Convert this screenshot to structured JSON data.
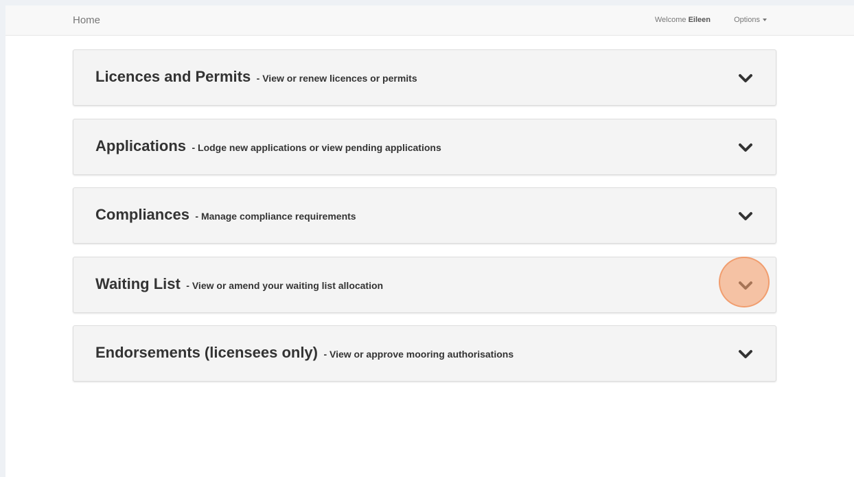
{
  "navbar": {
    "home_label": "Home",
    "welcome_prefix": "Welcome",
    "user_name": "Eileen",
    "options_label": "Options"
  },
  "panels": [
    {
      "title": "Licences and Permits",
      "description": "- View or renew licences or permits",
      "icon": "chevron-down-icon"
    },
    {
      "title": "Applications",
      "description": "- Lodge new applications or view pending applications",
      "icon": "chevron-down-icon"
    },
    {
      "title": "Compliances",
      "description": "- Manage compliance requirements",
      "icon": "chevron-down-icon"
    },
    {
      "title": "Waiting List",
      "description": "- View or amend your waiting list allocation",
      "icon": "chevron-down-icon"
    },
    {
      "title": "Endorsements (licensees only)",
      "description": "- View or approve mooring authorisations",
      "icon": "chevron-down-icon"
    }
  ],
  "colors": {
    "accent_highlight": "#f5a06e",
    "panel_background": "#f4f4f4",
    "text": "#333333"
  }
}
